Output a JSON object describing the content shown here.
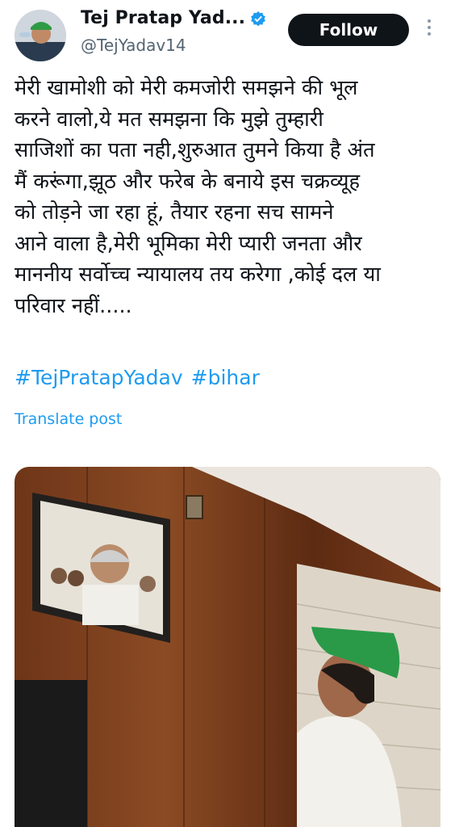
{
  "author": {
    "display_name": "Tej Pratap Yad...",
    "handle": "@TejYadav14",
    "verified_icon": "verified-badge-icon"
  },
  "actions": {
    "follow_label": "Follow",
    "more_icon": "more-vertical-icon"
  },
  "post": {
    "lines": [
      "मेरी खामोशी को मेरी कमजोरी समझने की भूल",
      "करने वालो,ये मत समझना कि मुझे तुम्हारी",
      "साजिशों का पता नही,शुरुआत तुमने किया है अंत",
      "मैं करूंगा,झूठ और फरेब के बनाये इस चक्रव्यूह",
      "को तोड़ने जा रहा हूं, तैयार रहना सच सामने",
      "आने वाला है,मेरी भूमिका मेरी प्यारी जनता और",
      "माननीय सर्वोच्च न्यायालय तय करेगा ,कोई दल या",
      "परिवार नहीं....."
    ],
    "hashtags": [
      "#TejPratapYadav",
      "#bihar"
    ],
    "translate_label": "Translate post"
  },
  "colors": {
    "link": "#1d9bf0",
    "text": "#0f1419",
    "secondary": "#536471",
    "follow_bg": "#0f1419"
  }
}
